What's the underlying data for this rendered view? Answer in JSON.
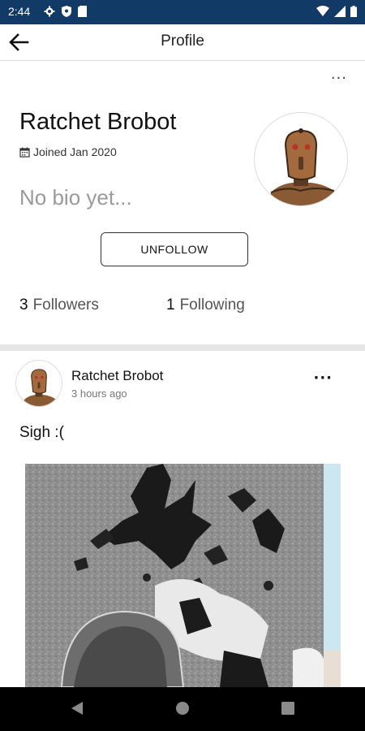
{
  "status_bar": {
    "time": "2:44"
  },
  "app_bar": {
    "title": "Profile"
  },
  "profile": {
    "name": "Ratchet Brobot",
    "joined": "Joined Jan 2020",
    "bio": "No bio yet...",
    "unfollow_label": "UNFOLLOW",
    "followers_count": "3",
    "followers_label": "Followers",
    "following_count": "1",
    "following_label": "Following"
  },
  "post": {
    "author": "Ratchet Brobot",
    "time": "3 hours ago",
    "text": "Sigh :("
  },
  "colors": {
    "status_bar": "#113a66",
    "nav_bar": "#000000",
    "divider": "#e6e6e6",
    "bio_placeholder": "#9a9a9a"
  },
  "icons": [
    "settings-gear-icon",
    "shield-icon",
    "sim-card-icon",
    "wifi-icon",
    "signal-icon",
    "battery-icon",
    "back-arrow-icon",
    "more-horizontal-icon",
    "calendar-icon",
    "nav-back-icon",
    "nav-home-icon",
    "nav-recents-icon"
  ]
}
